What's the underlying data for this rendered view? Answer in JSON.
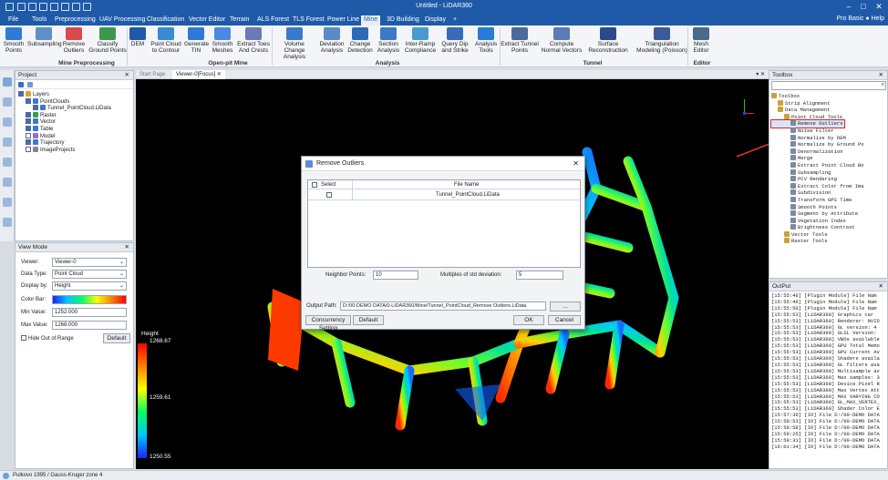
{
  "window": {
    "title": "Untitled - LiDAR360"
  },
  "menus": [
    "File",
    "Tools",
    "Preprocessing",
    "UAV Processing",
    "Classification",
    "Vector Editor",
    "Terrain",
    "ALS Forest",
    "TLS Forest",
    "Power Line",
    "Mine",
    "3D Building",
    "Display",
    "+"
  ],
  "menu_right": "Pro  Basic  ●  Help",
  "ribbon": {
    "buttons": [
      {
        "label": "Smooth Points",
        "icon": "smooth-points-icon"
      },
      {
        "label": "Subsampling",
        "icon": "subsampling-icon"
      },
      {
        "label": "Remove Outliers",
        "icon": "remove-outliers-icon"
      },
      {
        "label": "Classify Ground Points",
        "icon": "classify-ground-icon"
      },
      {
        "label": "DEM",
        "icon": "dem-icon"
      },
      {
        "label": "Point Cloud to Contour",
        "icon": "contour-icon"
      },
      {
        "label": "Generate TIN",
        "icon": "tin-icon"
      },
      {
        "label": "Smooth Meshes",
        "icon": "smooth-mesh-icon"
      },
      {
        "label": "Extract Toes And Crests",
        "icon": "toes-icon"
      },
      {
        "label": "Volume Change Analysis",
        "icon": "volume-icon"
      },
      {
        "label": "Deviation Analysis",
        "icon": "deviation-icon"
      },
      {
        "label": "Change Detection",
        "icon": "change-icon"
      },
      {
        "label": "Section Analysis",
        "icon": "section-icon"
      },
      {
        "label": "Inter-Ramp Compliance",
        "icon": "ramp-icon"
      },
      {
        "label": "Query Dip and Strike",
        "icon": "dip-icon"
      },
      {
        "label": "Analysis Tools",
        "icon": "analysis-tools-icon"
      },
      {
        "label": "Extract Tunnel Points",
        "icon": "tunnel-icon"
      },
      {
        "label": "Compute Normal Vectors",
        "icon": "normal-icon"
      },
      {
        "label": "Surface Reconstruction",
        "icon": "surface-icon"
      },
      {
        "label": "Triangulation Modeling (Poisson)",
        "icon": "poisson-icon"
      },
      {
        "label": "Mesh Editor",
        "icon": "mesh-editor-icon"
      }
    ],
    "groups": [
      "Mine Preprocessing",
      "Open-pit Mine",
      "Analysis",
      "Tunnel",
      "Editor"
    ]
  },
  "project": {
    "title": "Project",
    "tree": [
      {
        "label": "Layers",
        "indent": 0
      },
      {
        "label": "PointClouds",
        "indent": 1
      },
      {
        "label": "Tunnel_PointCloud.LiData",
        "indent": 2
      },
      {
        "label": "Raster",
        "indent": 1
      },
      {
        "label": "Vector",
        "indent": 1
      },
      {
        "label": "Table",
        "indent": 1
      },
      {
        "label": "Model",
        "indent": 1
      },
      {
        "label": "Trajectory",
        "indent": 1
      },
      {
        "label": "ImageProjects",
        "indent": 1
      }
    ]
  },
  "viewmode": {
    "title": "View Mode",
    "viewer_label": "Viewer:",
    "viewer_value": "Viewer-0",
    "datatype_label": "Data Type:",
    "datatype_value": "Point Cloud",
    "displayby_label": "Display by:",
    "displayby_value": "Height",
    "colorbar_label": "Color Bar:",
    "min_label": "Min Value:",
    "min_value": "1252.000",
    "max_label": "Max Value:",
    "max_value": "1268.000",
    "hide_label": "Hide Out of Range",
    "default_btn": "Default"
  },
  "viewer": {
    "tabs": [
      "Start Page",
      "Viewer-0[Focus]"
    ],
    "legend_title": "Height",
    "legend_max": "1268.67",
    "legend_mid": "1259.61",
    "legend_min": "1250.55"
  },
  "dialog": {
    "title": "Remove Outliers",
    "col_select": "Select",
    "col_file": "File Name",
    "row_file": "Tunnel_PointCloud.LiData",
    "neighbor_label": "Neighbor Points:",
    "neighbor_value": "10",
    "multiples_label": "Multiples of std deviation:",
    "multiples_value": "5",
    "output_label": "Output Path:",
    "output_value": "D:/00-DEMO DATA/0-LiDAR360/Mine/Tunnel_PointCloud_Remove Outliers.LiData",
    "browse": "...",
    "concurrency": "Concurrency Setting",
    "default": "Default",
    "ok": "OK",
    "cancel": "Cancel"
  },
  "toolbox": {
    "title": "Toolbox",
    "items": [
      {
        "label": "Toolbox",
        "indent": 0
      },
      {
        "label": "Strip Alignment",
        "indent": 1
      },
      {
        "label": "Data Management",
        "indent": 1
      },
      {
        "label": "Point Cloud Tools",
        "indent": 2
      },
      {
        "label": "Remove Outliers",
        "indent": 3
      },
      {
        "label": "Noise Filter",
        "indent": 3
      },
      {
        "label": "Normalize by DEM",
        "indent": 3
      },
      {
        "label": "Normalize by Ground Po",
        "indent": 3
      },
      {
        "label": "Denormalization",
        "indent": 3
      },
      {
        "label": "Merge",
        "indent": 3
      },
      {
        "label": "Extract Point Cloud Bo",
        "indent": 3
      },
      {
        "label": "Subsampling",
        "indent": 3
      },
      {
        "label": "PCV Rendering",
        "indent": 3
      },
      {
        "label": "Extract Color from Ima",
        "indent": 3
      },
      {
        "label": "Subdivision",
        "indent": 3
      },
      {
        "label": "Transform GPS Time",
        "indent": 3
      },
      {
        "label": "Smooth Points",
        "indent": 3
      },
      {
        "label": "Segment by Attribute",
        "indent": 3
      },
      {
        "label": "Vegetation Index",
        "indent": 3
      },
      {
        "label": "Brightness Contrast",
        "indent": 3
      },
      {
        "label": "Vector Tools",
        "indent": 2
      },
      {
        "label": "Raster Tools",
        "indent": 2
      }
    ]
  },
  "output": {
    "title": "OutPut",
    "lines": [
      "[15:55:46] [Plugin Module]    File Nam",
      "[15:55:46] [Plugin Module]    File Nam",
      "[15:55:50] [Plugin Module]    File Nam",
      "[15:55:53] [LiDAR360]    Graphics car",
      "[15:55:53] [LiDAR360]    Renderer: NVID",
      "[15:55:53] [LiDAR360]    GL version: 4",
      "[15:55:53] [LiDAR360]    GLSL Version:",
      "[15:55:53] [LiDAR360]    VBOs available",
      "[15:55:53] [LiDAR360]    GPU Total Memo",
      "[15:55:53] [LiDAR360]    GPU Current Av",
      "[15:55:53] [LiDAR360]    Shaders availa",
      "[15:55:53] [LiDAR360]    GL filters ava",
      "[15:55:53] [LiDAR360]    Multisample av",
      "[15:55:53] [LiDAR360]    Max samples: 3",
      "[15:55:53] [LiDAR360]    Device Pixel R",
      "[15:55:53] [LiDAR360]    Max Vertex Att",
      "[15:55:53] [LiDAR360]    MAX VARYING CO",
      "[15:55:53] [LiDAR360]    GL_MAX_VERTEX_",
      "[15:55:53] [LiDAR360]    Shader Color E",
      "[15:57:36] [IO]    File D:/00-DEMO DATA",
      "[15:58:53] [IO]    File D:/00-DEMO DATA",
      "[15:58:58] [IO]    File D:/00-DEMO DATA",
      "[15:59:25] [IO]    File D:/00-DEMO DATA",
      "[15:59:31] [IO]    File D:/00-DEMO DATA",
      "[16:01:34] [IO]    File D:/00-DEMO DATA"
    ]
  },
  "statusbar": {
    "text": "Pulkovo 1995 / Gauss-Kruger zone 4"
  },
  "colors": {
    "accent": "#1e5aa8",
    "highlight": "#e02020",
    "arrow": "#e03030"
  }
}
